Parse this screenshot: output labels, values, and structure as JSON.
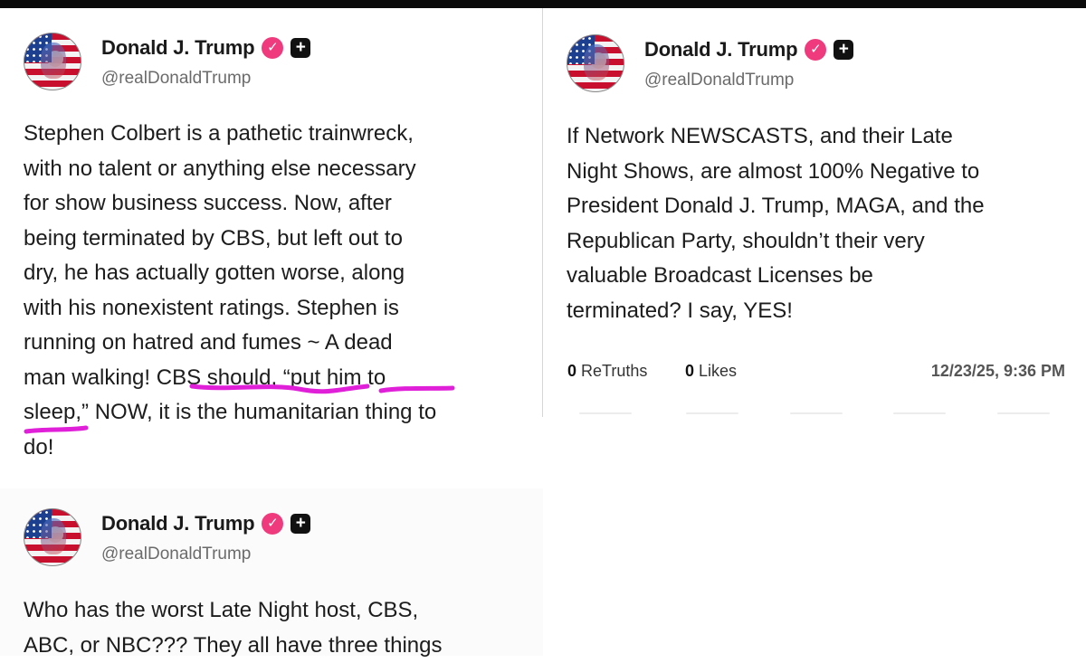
{
  "posts": [
    {
      "author": "Donald J. Trump",
      "handle": "@realDonaldTrump",
      "verified_icon": "✓",
      "plus_icon": "+",
      "lines": [
        "Stephen Colbert is a pathetic trainwreck,",
        "with no talent or anything else necessary",
        "for show business success. Now, after",
        "being terminated by CBS, but left out to",
        "dry, he has actually gotten worse, along",
        "with his nonexistent ratings. Stephen is",
        "running on hatred and fumes ~ A dead",
        "man walking! CBS should, “put him to",
        "sleep,” NOW, it is the humanitarian thing to",
        "do!"
      ]
    },
    {
      "author": "Donald J. Trump",
      "handle": "@realDonaldTrump",
      "verified_icon": "✓",
      "plus_icon": "+",
      "lines": [
        "If Network NEWSCASTS, and their Late",
        "Night Shows, are almost 100% Negative to",
        "President Donald J. Trump, MAGA, and the",
        "Republican Party, shouldn’t their very",
        "valuable Broadcast Licenses be",
        "terminated? I say, YES!"
      ],
      "retruths_count": "0",
      "retruths_label": "ReTruths",
      "likes_count": "0",
      "likes_label": "Likes",
      "timestamp": "12/23/25, 9:36 PM"
    },
    {
      "author": "Donald J. Trump",
      "handle": "@realDonaldTrump",
      "verified_icon": "✓",
      "plus_icon": "+",
      "lines": [
        "Who has the worst Late Night host, CBS,",
        "ABC, or NBC??? They all have three things"
      ]
    }
  ],
  "annotation_color": "#e020d8",
  "verified_color": "#ef3b7d"
}
